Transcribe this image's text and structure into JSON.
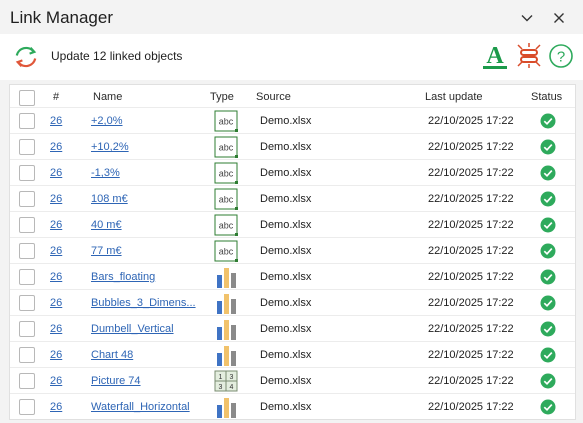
{
  "window": {
    "title": "Link Manager"
  },
  "toolbar": {
    "update_label": "Update 12 linked objects"
  },
  "columns": {
    "num": "#",
    "name": "Name",
    "type": "Type",
    "source": "Source",
    "last_update": "Last update",
    "status": "Status"
  },
  "colors": {
    "link": "#2e65b5",
    "status_ok": "#2eaa5c",
    "accent_green": "#1b9a4a",
    "link_red": "#d94c2a"
  },
  "rows": [
    {
      "num": "26",
      "name": "+2,0%",
      "type": "text-icon",
      "source": "Demo.xlsx",
      "last_update": "22/10/2025 17:22",
      "status": "check-icon"
    },
    {
      "num": "26",
      "name": "+10,2%",
      "type": "text-icon",
      "source": "Demo.xlsx",
      "last_update": "22/10/2025 17:22",
      "status": "check-icon"
    },
    {
      "num": "26",
      "name": "-1,3%",
      "type": "text-icon",
      "source": "Demo.xlsx",
      "last_update": "22/10/2025 17:22",
      "status": "check-icon"
    },
    {
      "num": "26",
      "name": "108 m€",
      "type": "text-icon",
      "source": "Demo.xlsx",
      "last_update": "22/10/2025 17:22",
      "status": "check-icon"
    },
    {
      "num": "26",
      "name": "40 m€",
      "type": "text-icon",
      "source": "Demo.xlsx",
      "last_update": "22/10/2025 17:22",
      "status": "check-icon"
    },
    {
      "num": "26",
      "name": "77 m€",
      "type": "text-icon",
      "source": "Demo.xlsx",
      "last_update": "22/10/2025 17:22",
      "status": "check-icon"
    },
    {
      "num": "26",
      "name": "Bars_floating",
      "type": "chart-icon",
      "source": "Demo.xlsx",
      "last_update": "22/10/2025 17:22",
      "status": "check-icon"
    },
    {
      "num": "26",
      "name": "Bubbles_3_Dimens...",
      "type": "chart-icon",
      "source": "Demo.xlsx",
      "last_update": "22/10/2025 17:22",
      "status": "check-icon"
    },
    {
      "num": "26",
      "name": "Dumbell_Vertical",
      "type": "chart-icon",
      "source": "Demo.xlsx",
      "last_update": "22/10/2025 17:22",
      "status": "check-icon"
    },
    {
      "num": "26",
      "name": "Chart 48",
      "type": "chart-icon",
      "source": "Demo.xlsx",
      "last_update": "22/10/2025 17:22",
      "status": "check-icon"
    },
    {
      "num": "26",
      "name": "Picture 74",
      "type": "table-icon",
      "source": "Demo.xlsx",
      "last_update": "22/10/2025 17:22",
      "status": "check-icon"
    },
    {
      "num": "26",
      "name": "Waterfall_Horizontal",
      "type": "chart-icon",
      "source": "Demo.xlsx",
      "last_update": "22/10/2025 17:22",
      "status": "check-icon"
    }
  ]
}
